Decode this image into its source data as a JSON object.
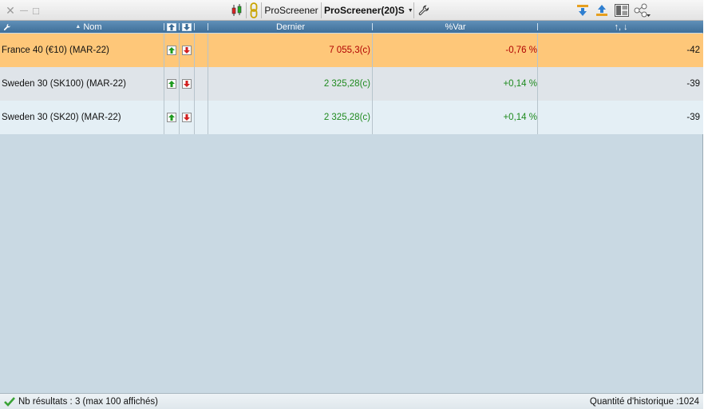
{
  "toolbar": {
    "window_controls": {
      "close": "✕",
      "minimize": "—",
      "maximize": "□"
    },
    "screener_label": "ProScreener",
    "screener_dropdown": "ProScreener(20)S",
    "icons": [
      "candlestick-icon",
      "link-icon",
      "wrench-icon",
      "arrow-down-icon",
      "arrow-up-icon",
      "layout-icon",
      "share-icon"
    ]
  },
  "columns": {
    "tools": "🔧",
    "name": "Nom",
    "sort_indicator": "▲",
    "last": "Dernier",
    "var": "%Var",
    "hist": "↑, ↓"
  },
  "rows": [
    {
      "name": "France 40 (€10) (MAR-22)",
      "last": "7 055,3(c)",
      "var": "-0,76 %",
      "hist": "-42",
      "trend": "down",
      "selected": true
    },
    {
      "name": "Sweden 30 (SK100) (MAR-22)",
      "last": "2 325,28(c)",
      "var": "+0,14 %",
      "hist": "-39",
      "trend": "up",
      "selected": false
    },
    {
      "name": "Sweden 30 (SK20) (MAR-22)",
      "last": "2 325,28(c)",
      "var": "+0,14 %",
      "hist": "-39",
      "trend": "up",
      "selected": false
    }
  ],
  "status": {
    "results": "Nb résultats : 3 (max 100 affichés)",
    "history": "Quantité d'historique :1024"
  },
  "colors": {
    "selected_row": "#fec779",
    "row_alt": "#dfe4e9",
    "row_light": "#e4eff5",
    "header": "#4f80aa",
    "negative": "#b00000",
    "positive": "#1e8a1e",
    "background": "#c9d9e3"
  }
}
